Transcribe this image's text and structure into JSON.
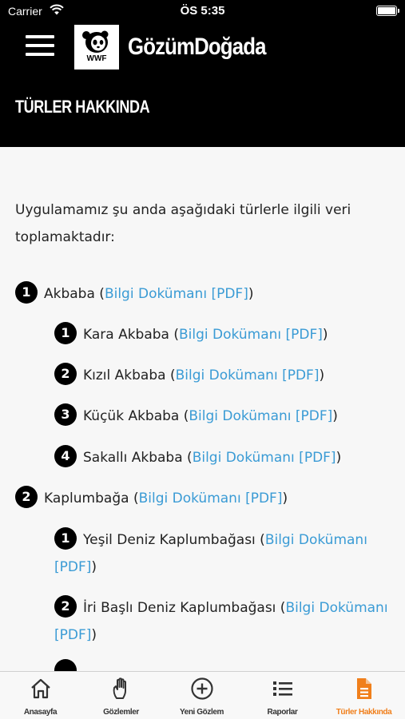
{
  "status_bar": {
    "carrier": "Carrier",
    "time": "ÖS 5:35"
  },
  "header": {
    "app_title": "GözümDoğada",
    "section_title": "TÜRLER HAKKINDA",
    "logo_text": "WWF"
  },
  "content": {
    "intro": "Uygulamamız şu anda aşağıdaki türlerle ilgili veri toplamaktadır:",
    "link_text": "Bilgi Dokümanı [PDF]",
    "groups": [
      {
        "number": "1",
        "name": "Akbaba",
        "children": [
          {
            "number": "1",
            "name": "Kara Akbaba"
          },
          {
            "number": "2",
            "name": "Kızıl Akbaba"
          },
          {
            "number": "3",
            "name": "Küçük Akbaba"
          },
          {
            "number": "4",
            "name": "Sakallı Akbaba"
          }
        ]
      },
      {
        "number": "2",
        "name": "Kaplumbağa",
        "children": [
          {
            "number": "1",
            "name": "Yeşil Deniz Kaplumbağası"
          },
          {
            "number": "2",
            "name": "İri Başlı Deniz Kaplumbağası"
          }
        ]
      }
    ]
  },
  "tabbar": {
    "active_color": "#f07f1b",
    "tabs": [
      {
        "label": "Anasayfa",
        "icon": "home-icon"
      },
      {
        "label": "Gözlemler",
        "icon": "hand-icon"
      },
      {
        "label": "Yeni Gözlem",
        "icon": "plus-circle-icon"
      },
      {
        "label": "Raporlar",
        "icon": "list-icon"
      },
      {
        "label": "Türler Hakkında",
        "icon": "document-icon",
        "active": true
      }
    ]
  }
}
